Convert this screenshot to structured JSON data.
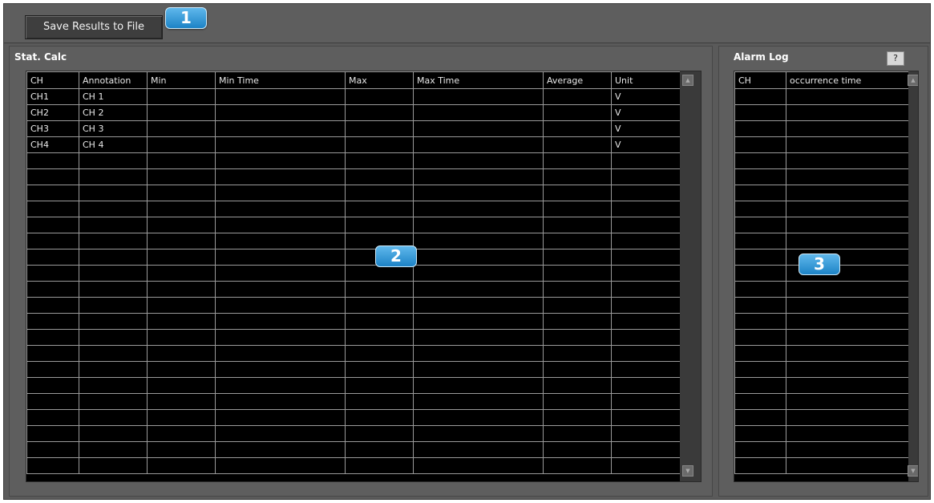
{
  "toolbar": {
    "save_label": "Save Results to File"
  },
  "badges": [
    "1",
    "2",
    "3"
  ],
  "stat_calc": {
    "title": "Stat. Calc",
    "columns": [
      "CH",
      "Annotation",
      "Min",
      "Min Time",
      "Max",
      "Max Time",
      "Average",
      "Unit"
    ],
    "rows": [
      [
        "CH1",
        "CH 1",
        "",
        "",
        "",
        "",
        "",
        "V"
      ],
      [
        "CH2",
        "CH 2",
        "",
        "",
        "",
        "",
        "",
        "V"
      ],
      [
        "CH3",
        "CH 3",
        "",
        "",
        "",
        "",
        "",
        "V"
      ],
      [
        "CH4",
        "CH 4",
        "",
        "",
        "",
        "",
        "",
        "V"
      ]
    ]
  },
  "alarm_log": {
    "title": "Alarm Log",
    "help_label": "?",
    "columns": [
      "CH",
      "occurrence time"
    ],
    "rows": []
  },
  "scroll_icons": {
    "up": "▲",
    "down": "▼"
  },
  "colors": {
    "badge": "#1d83c6",
    "grid_bg": "#000000",
    "panel_bg": "#5e5e5e"
  }
}
